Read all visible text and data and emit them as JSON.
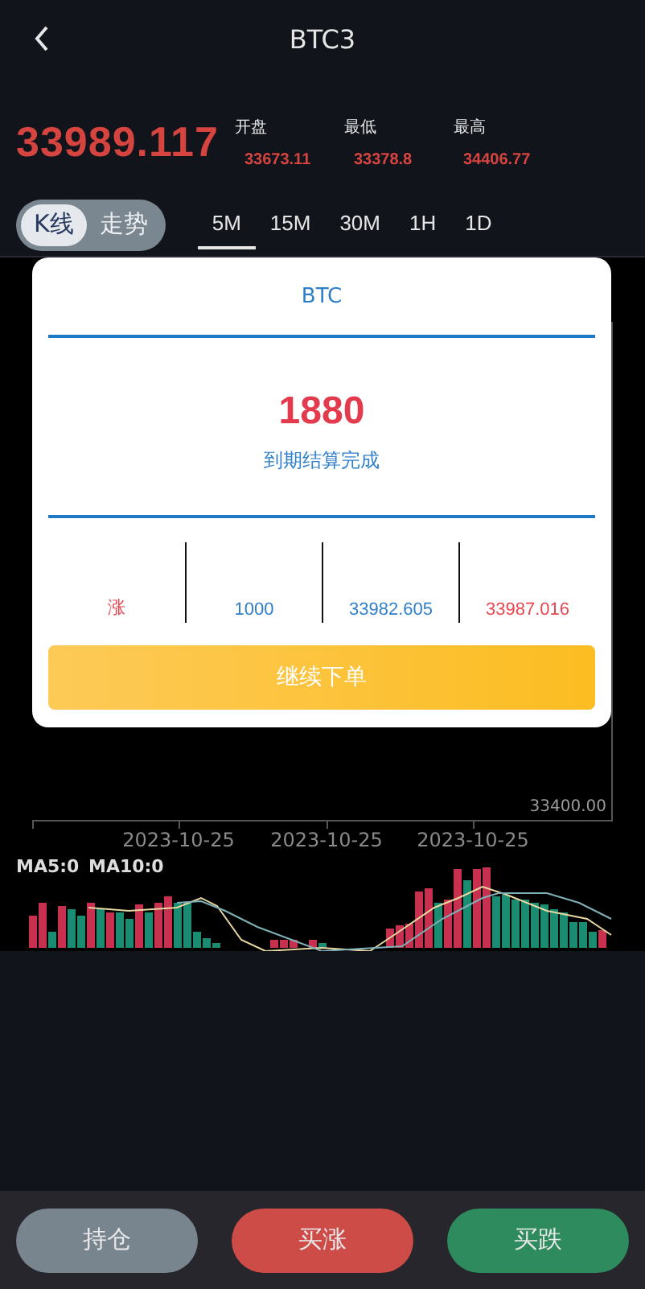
{
  "header": {
    "title": "BTC3"
  },
  "quote": {
    "price": "33989.117",
    "stats": [
      {
        "label": "开盘",
        "value": "33673.11"
      },
      {
        "label": "最低",
        "value": "33378.8"
      },
      {
        "label": "最高",
        "value": "34406.77"
      }
    ]
  },
  "chart_mode": [
    {
      "label": "K线",
      "selected": true
    },
    {
      "label": "走势",
      "selected": false
    }
  ],
  "periods": [
    {
      "label": "5M",
      "selected": true
    },
    {
      "label": "15M",
      "selected": false
    },
    {
      "label": "30M",
      "selected": false
    },
    {
      "label": "1H",
      "selected": false
    },
    {
      "label": "1D",
      "selected": false
    }
  ],
  "chart": {
    "y_label": "33400.00",
    "x_labels": [
      "2023-10-25",
      "2023-10-25",
      "2023-10-25"
    ],
    "ma_labels": [
      "MA5:0",
      "MA10:0"
    ]
  },
  "dialog": {
    "title": "BTC",
    "amount": "1880",
    "status": "到期结算完成",
    "details": [
      {
        "text": "涨",
        "color": "#e8474f"
      },
      {
        "text": "1000",
        "color": "#2f7fc9"
      },
      {
        "text": "33982.605",
        "color": "#2f7fc9"
      },
      {
        "text": "33987.016",
        "color": "#e8474f"
      }
    ],
    "button": "继续下单"
  },
  "actions": [
    {
      "label": "持仓",
      "kind": "neutral"
    },
    {
      "label": "买涨",
      "kind": "up"
    },
    {
      "label": "买跌",
      "kind": "down"
    }
  ]
}
